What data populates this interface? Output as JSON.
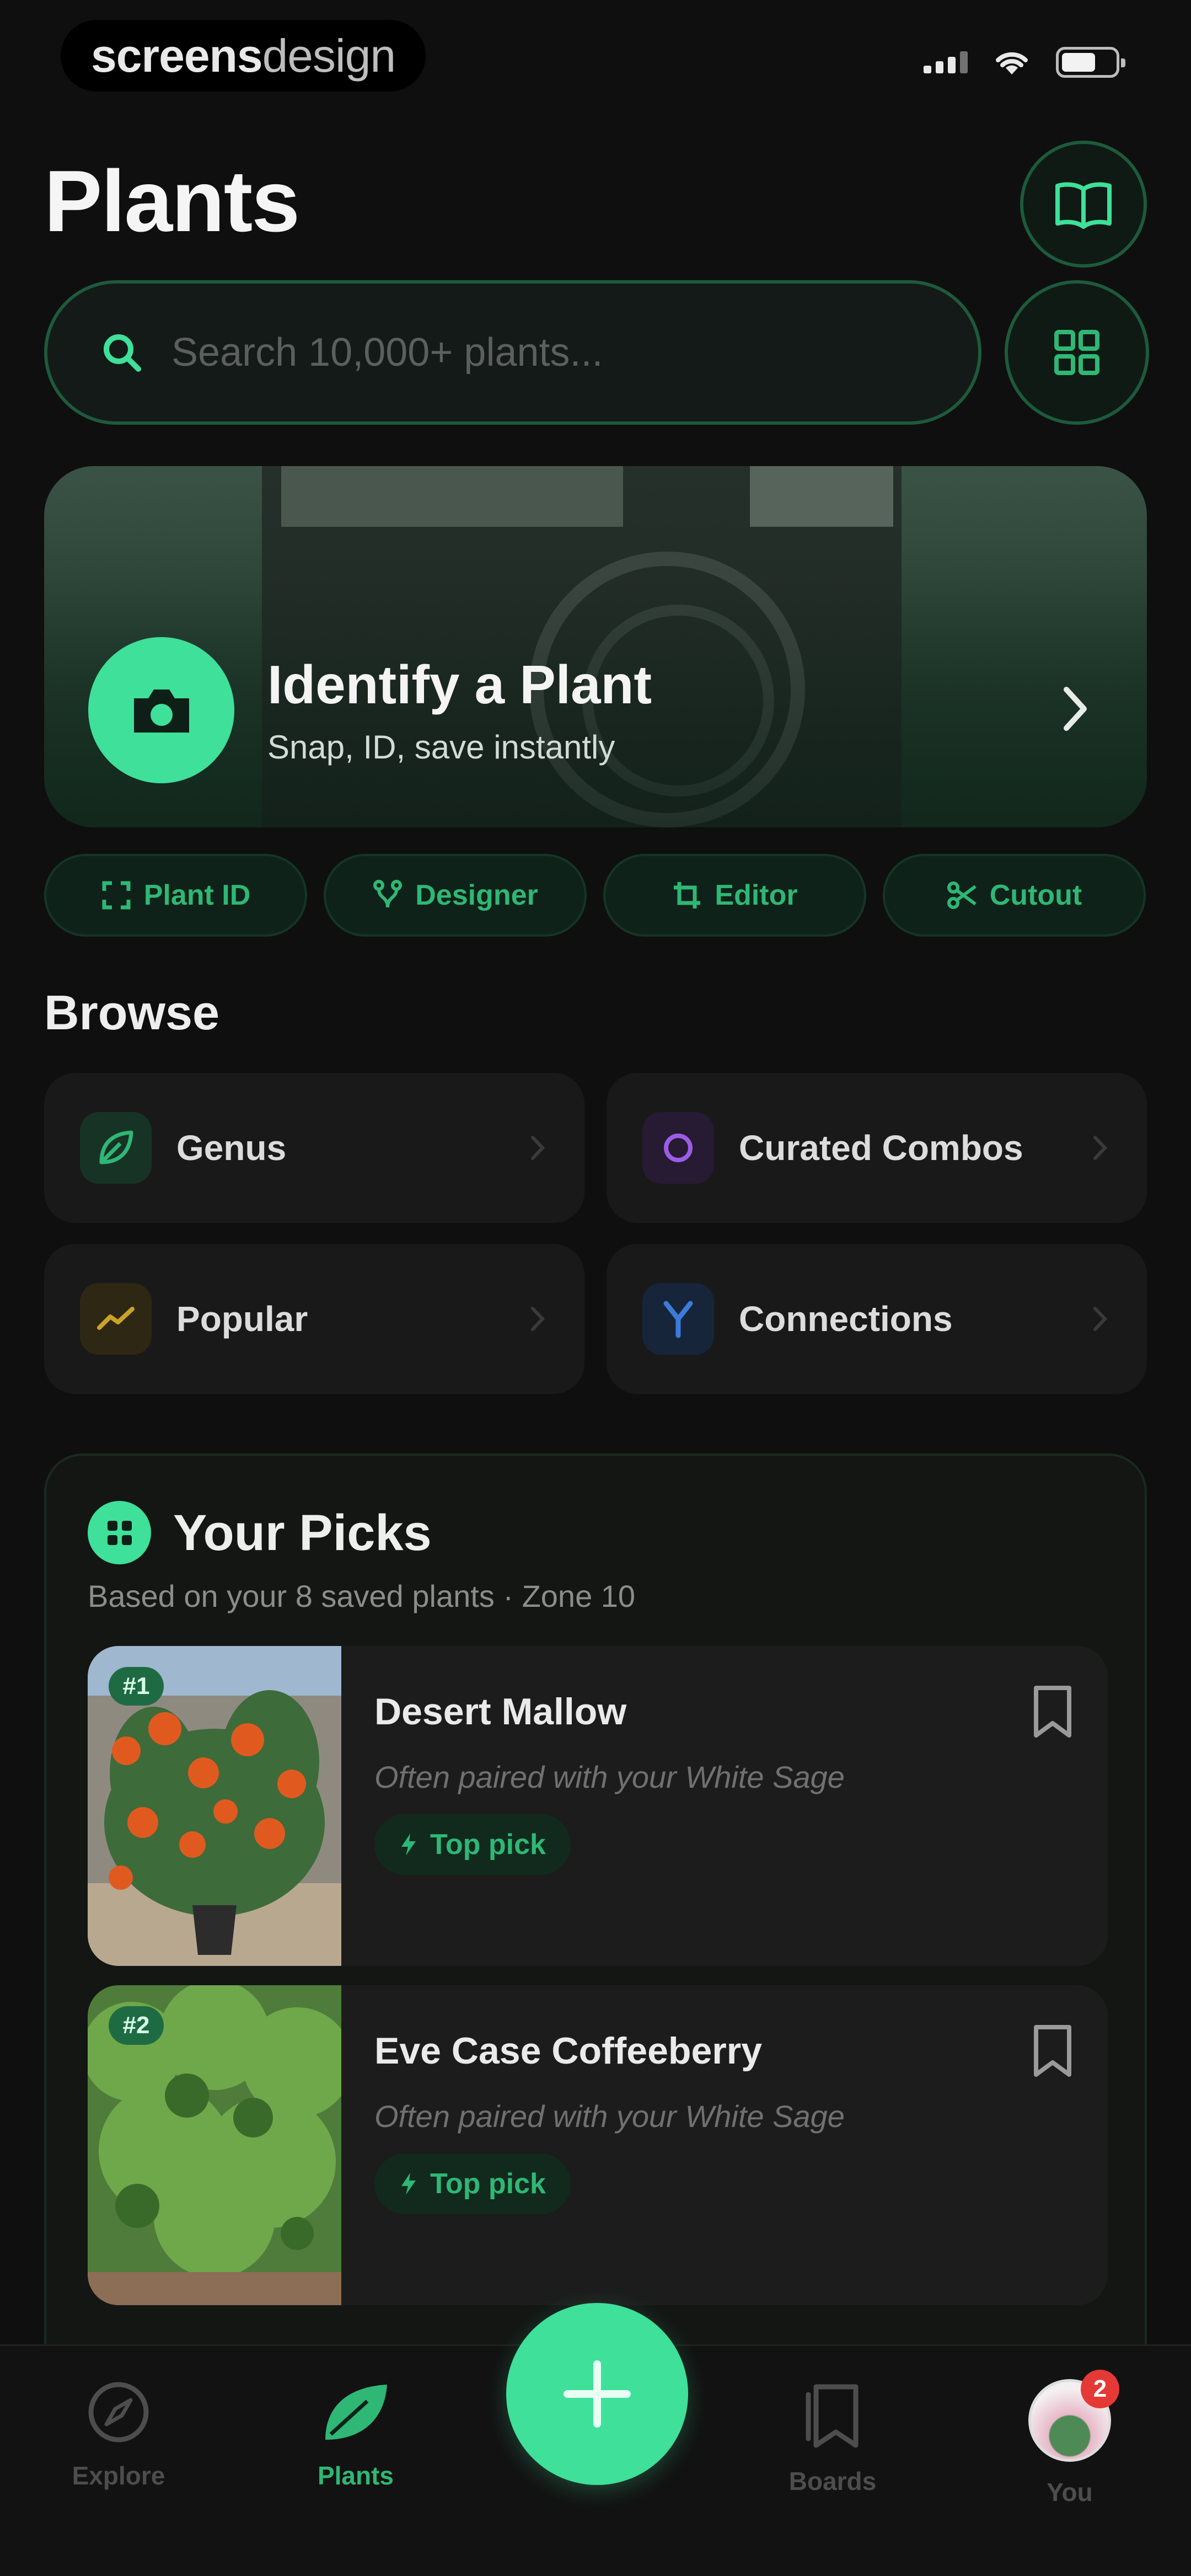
{
  "status_bar": {
    "brand_bold": "screens",
    "brand_light": "design"
  },
  "header": {
    "title": "Plants"
  },
  "search": {
    "placeholder": "Search 10,000+ plants..."
  },
  "hero": {
    "title": "Identify a Plant",
    "subtitle": "Snap, ID, save instantly"
  },
  "chips": [
    {
      "label": "Plant ID",
      "icon": "scan-icon"
    },
    {
      "label": "Designer",
      "icon": "branch-icon"
    },
    {
      "label": "Editor",
      "icon": "crop-icon"
    },
    {
      "label": "Cutout",
      "icon": "scissors-icon"
    }
  ],
  "browse": {
    "title": "Browse",
    "items": [
      {
        "label": "Genus",
        "icon": "leaf-icon",
        "color": "#2fb775"
      },
      {
        "label": "Curated Combos",
        "icon": "ring-icon",
        "color": "#9b5de5"
      },
      {
        "label": "Popular",
        "icon": "trend-icon",
        "color": "#c9a227"
      },
      {
        "label": "Connections",
        "icon": "fork-icon",
        "color": "#3d7bd9"
      }
    ]
  },
  "picks": {
    "title": "Your Picks",
    "subtitle": "Based on your 8 saved plants · Zone 10",
    "items": [
      {
        "rank": "#1",
        "name": "Desert Mallow",
        "note": "Often paired with your White Sage",
        "tag": "Top pick"
      },
      {
        "rank": "#2",
        "name": "Eve Case Coffeeberry",
        "note": "Often paired with your White Sage",
        "tag": "Top pick"
      }
    ]
  },
  "tabbar": {
    "explore": "Explore",
    "plants": "Plants",
    "boards": "Boards",
    "you": "You",
    "you_badge": "2"
  },
  "colors": {
    "accent": "#3ee09a",
    "accent_text": "#2fb775",
    "background": "#0f0f0f"
  }
}
